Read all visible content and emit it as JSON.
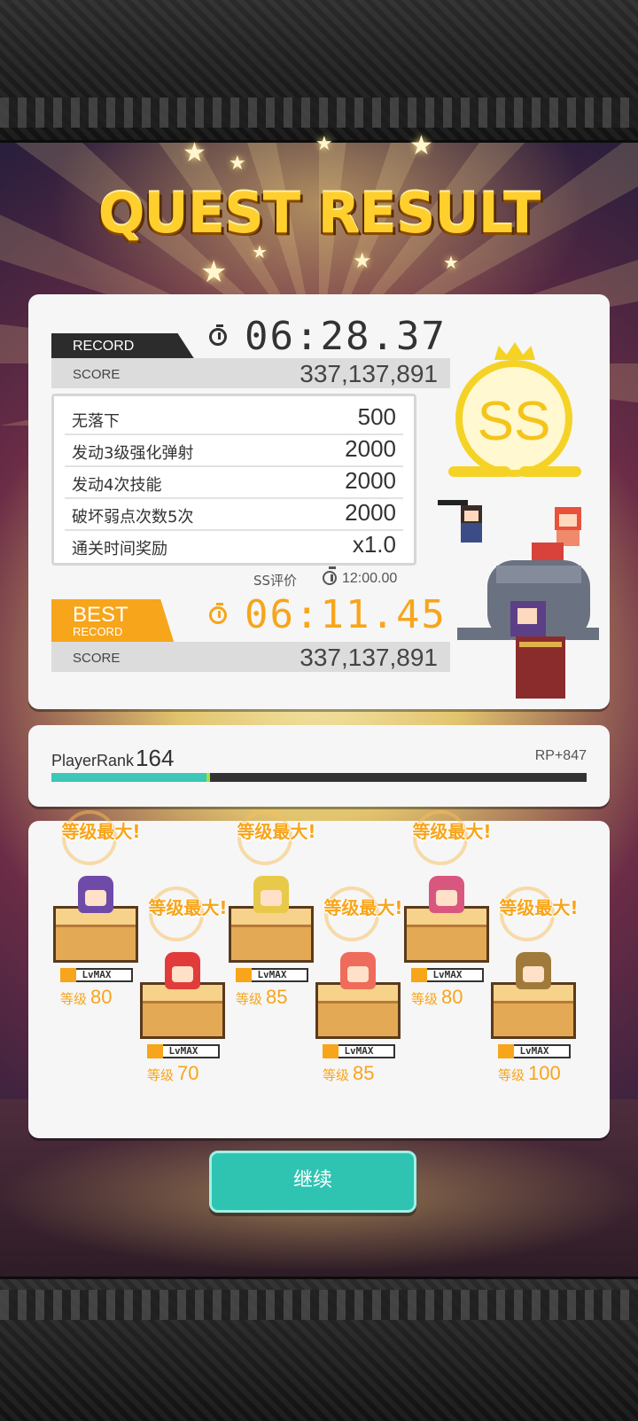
{
  "title": "QUEST RESULT",
  "record": {
    "tag": "RECORD",
    "time": "06:28.37",
    "score_label": "SCORE",
    "score": "337,137,891"
  },
  "bonuses": [
    {
      "label": "无落下",
      "value": "500"
    },
    {
      "label": "发动3级强化弹射",
      "value": "2000"
    },
    {
      "label": "发动4次技能",
      "value": "2000"
    },
    {
      "label": "破坏弱点次数5次",
      "value": "2000"
    },
    {
      "label": "通关时间奖励",
      "value": "x1.0"
    }
  ],
  "ss_requirement": {
    "label": "SS评价",
    "time": "12:00.00"
  },
  "best": {
    "tag_big": "BEST",
    "tag_small": "RECORD",
    "time": "06:11.45",
    "score_label": "SCORE",
    "score": "337,137,891"
  },
  "grade": "SS",
  "player_rank": {
    "label": "PlayerRank",
    "value": "164",
    "rp": "RP+847",
    "progress": 0.29
  },
  "characters": [
    {
      "max_text": "等级最大!",
      "lvmax": "LvMAX",
      "level_label": "等级",
      "level": "80",
      "hair": "#6f4aa8"
    },
    {
      "max_text": "等级最大!",
      "lvmax": "LvMAX",
      "level_label": "等级",
      "level": "70",
      "hair": "#e23b3b"
    },
    {
      "max_text": "等级最大!",
      "lvmax": "LvMAX",
      "level_label": "等级",
      "level": "85",
      "hair": "#e9c94a"
    },
    {
      "max_text": "等级最大!",
      "lvmax": "LvMAX",
      "level_label": "等级",
      "level": "85",
      "hair": "#ef6b5b"
    },
    {
      "max_text": "等级最大!",
      "lvmax": "LvMAX",
      "level_label": "等级",
      "level": "80",
      "hair": "#d9577f"
    },
    {
      "max_text": "等级最大!",
      "lvmax": "LvMAX",
      "level_label": "等级",
      "level": "100",
      "hair": "#a07a3a"
    }
  ],
  "continue_label": "继续",
  "colors": {
    "accent_orange": "#f7a51b",
    "teal": "#2fc4b2",
    "gold": "#f4d326"
  }
}
